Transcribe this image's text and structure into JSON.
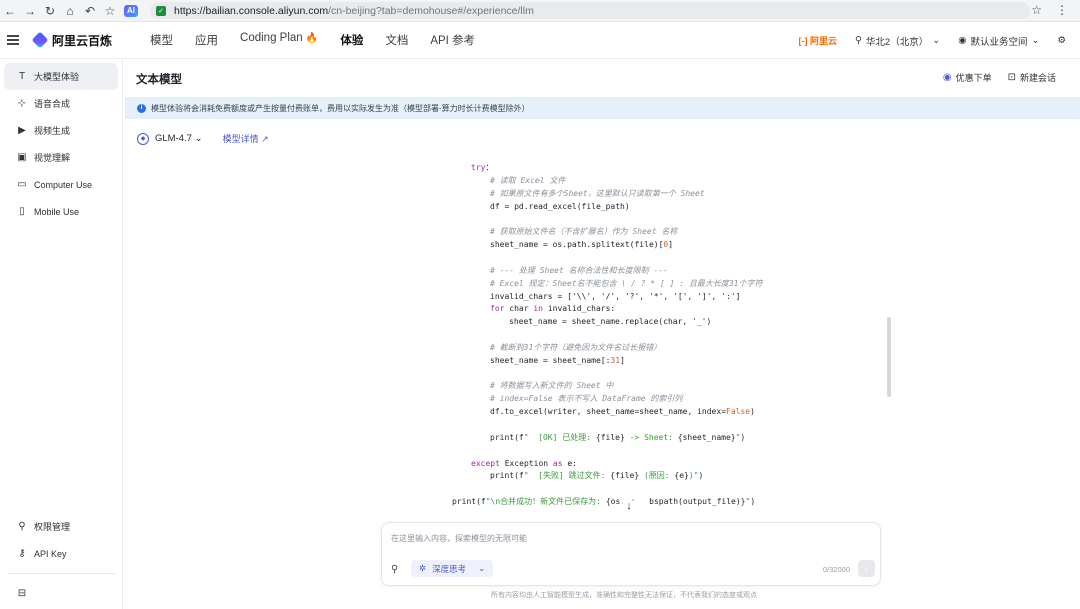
{
  "browser": {
    "url_main": "https://bailian.console.aliyun.com",
    "url_rest": "/cn-beijing?tab=demohouse#/experience/llm"
  },
  "header": {
    "logo": "阿里云百炼",
    "nav": [
      "模型",
      "应用",
      "Coding Plan",
      "体验",
      "文档",
      "API 参考"
    ],
    "brand": "[-] 阿里云",
    "region": "华北2（北京）",
    "workspace": "默认业务空间"
  },
  "sidebar": {
    "items": [
      {
        "icon": "T",
        "label": "大模型体验"
      },
      {
        "icon": "⊹",
        "label": "语音合成"
      },
      {
        "icon": "▶",
        "label": "视频生成"
      },
      {
        "icon": "▣",
        "label": "视觉理解"
      },
      {
        "icon": "▭",
        "label": "Computer Use"
      },
      {
        "icon": "▯",
        "label": "Mobile Use"
      }
    ],
    "bottom": [
      {
        "icon": "⚲",
        "label": "权限管理"
      },
      {
        "icon": "⚷",
        "label": "API Key"
      }
    ]
  },
  "page": {
    "title": "文本模型",
    "discount": "优惠下单",
    "new_chat": "新建会话",
    "notice": "模型体验将会消耗免费额度或产生按量付费账单，费用以实际发生为准（模型部署-算力时长计费模型除外）",
    "model": "GLM-4.7",
    "model_detail": "模型详情 ↗"
  },
  "code_lines": [
    {
      "i": 0,
      "segs": [
        [
          "kw",
          "try"
        ],
        [
          "",
          "："
        ]
      ]
    },
    {
      "i": 1,
      "segs": [
        [
          "cm",
          "# 读取 Excel 文件"
        ]
      ]
    },
    {
      "i": 1,
      "segs": [
        [
          "cm",
          "# 如果原文件有多个Sheet，这里默认只读取第一个 Sheet"
        ]
      ]
    },
    {
      "i": 1,
      "segs": [
        [
          "",
          "df = pd.read_excel(file_path)"
        ]
      ]
    },
    {
      "i": 1,
      "segs": []
    },
    {
      "i": 1,
      "segs": [
        [
          "cm",
          "# 获取原始文件名（不含扩展名）作为 Sheet 名称"
        ]
      ]
    },
    {
      "i": 1,
      "segs": [
        [
          "",
          "sheet_name = os.path.splitext(file)["
        ],
        [
          "nm",
          "0"
        ],
        [
          "",
          "]"
        ]
      ]
    },
    {
      "i": 1,
      "segs": []
    },
    {
      "i": 1,
      "segs": [
        [
          "cm",
          "# --- 处理 Sheet 名称合法性和长度限制 ---"
        ]
      ]
    },
    {
      "i": 1,
      "segs": [
        [
          "cm",
          "# Excel 规定：Sheet名不能包含 \\ / ? * [ ] : 且最大长度31个字符"
        ]
      ]
    },
    {
      "i": 1,
      "segs": [
        [
          "",
          "invalid_chars = ['\\\\', '/', '?', '*', '[', ']', ':']"
        ]
      ]
    },
    {
      "i": 1,
      "segs": [
        [
          "kw",
          "for"
        ],
        [
          "",
          " char "
        ],
        [
          "kw",
          "in"
        ],
        [
          "",
          " invalid_chars:"
        ]
      ]
    },
    {
      "i": 2,
      "segs": [
        [
          "",
          "sheet_name = sheet_name.replace(char, '_')"
        ]
      ]
    },
    {
      "i": 1,
      "segs": []
    },
    {
      "i": 1,
      "segs": [
        [
          "cm",
          "# 截断到31个字符（避免因为文件名过长报错）"
        ]
      ]
    },
    {
      "i": 1,
      "segs": [
        [
          "",
          "sheet_name = sheet_name[:"
        ],
        [
          "nm",
          "31"
        ],
        [
          "",
          "]"
        ]
      ]
    },
    {
      "i": 1,
      "segs": []
    },
    {
      "i": 1,
      "segs": [
        [
          "cm",
          "# 将数据写入新文件的 Sheet 中"
        ]
      ]
    },
    {
      "i": 1,
      "segs": [
        [
          "cm",
          "# index=False 表示不写入 DataFrame 的索引列"
        ]
      ]
    },
    {
      "i": 1,
      "segs": [
        [
          "",
          "df.to_excel(writer, sheet_name=sheet_name, index="
        ],
        [
          "nm",
          "False"
        ],
        [
          "",
          ")"
        ]
      ]
    },
    {
      "i": 1,
      "segs": []
    },
    {
      "i": 1,
      "segs": [
        [
          "",
          "print(f"
        ],
        [
          "st",
          "\"  [OK] 已处理: "
        ],
        [
          "",
          "{file}"
        ],
        [
          "st",
          " -> Sheet: "
        ],
        [
          "",
          "{sheet_name}"
        ],
        [
          "st",
          "\""
        ],
        [
          "",
          ")"
        ]
      ]
    },
    {
      "i": 1,
      "segs": []
    },
    {
      "i": 0,
      "segs": [
        [
          "kw",
          "except"
        ],
        [
          "",
          " Exception "
        ],
        [
          "kw",
          "as"
        ],
        [
          "",
          " e:"
        ]
      ]
    },
    {
      "i": 1,
      "segs": [
        [
          "",
          "print(f"
        ],
        [
          "st",
          "\"  [失败] 跳过文件: "
        ],
        [
          "",
          "{file}"
        ],
        [
          "st",
          " (原因: "
        ],
        [
          "",
          "{e}"
        ],
        [
          "st",
          ")\""
        ],
        [
          "",
          ")"
        ]
      ]
    },
    {
      "i": 1,
      "segs": []
    },
    {
      "i": -1,
      "segs": [
        [
          "",
          "print(f"
        ],
        [
          "st",
          "\"\\n合并成功！新文件已保存为: "
        ],
        [
          "",
          "{os.pa   bspath(output_file)}"
        ],
        [
          "st",
          "\""
        ],
        [
          "",
          ")"
        ]
      ]
    }
  ],
  "chat": {
    "placeholder": "在这里输入内容，探索模型的无限可能",
    "deep_think": "深度思考",
    "counter": "0/32000",
    "disclaimer": "所有内容均由人工智能模型生成，准确性和完整性无法保证，不代表我们的态度或观点"
  }
}
